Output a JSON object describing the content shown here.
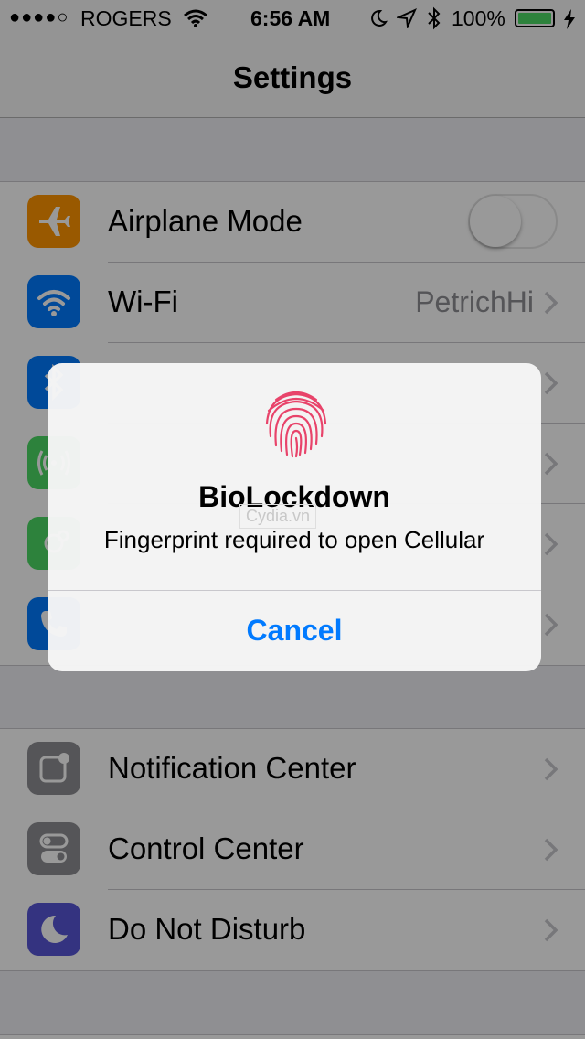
{
  "status_bar": {
    "carrier": "ROGERS",
    "time": "6:56 AM",
    "battery": "100%",
    "signal_dots": "●●●●○"
  },
  "nav": {
    "title": "Settings"
  },
  "group1": [
    {
      "label": "Airplane Mode",
      "icon": "airplane-icon",
      "color": "#ff9500",
      "control": "toggle",
      "toggle_on": false
    },
    {
      "label": "Wi-Fi",
      "value": "PetrichHi",
      "icon": "wifi-icon",
      "color": "#007aff"
    },
    {
      "label": "",
      "icon": "bluetooth-icon",
      "color": "#007aff"
    },
    {
      "label": "",
      "icon": "cellular-icon",
      "color": "#4cd964"
    },
    {
      "label": "",
      "icon": "personal-hotspot-icon",
      "color": "#4cd964"
    },
    {
      "label": "",
      "icon": "carrier-phone-icon",
      "color": "#007aff"
    }
  ],
  "group2": [
    {
      "label": "Notification Center",
      "icon": "notification-center-icon",
      "color": "#8e8e93"
    },
    {
      "label": "Control Center",
      "icon": "control-center-icon",
      "color": "#8e8e93"
    },
    {
      "label": "Do Not Disturb",
      "icon": "moon-icon",
      "color": "#5856d6"
    }
  ],
  "alert": {
    "title": "BioLockdown",
    "message": "Fingerprint required to open Cellular",
    "cancel": "Cancel",
    "watermark": "Cydia.vn"
  }
}
